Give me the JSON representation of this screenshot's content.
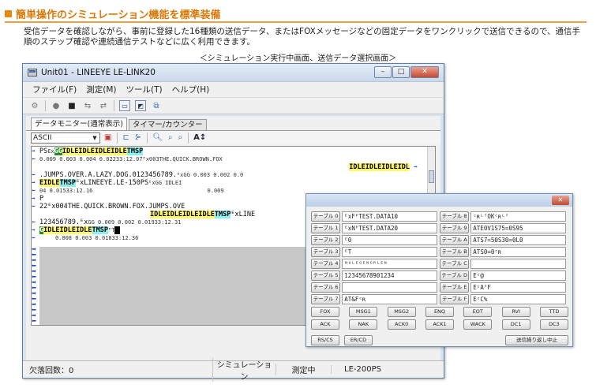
{
  "header": {
    "heading": "簡単操作のシミュレーション機能を標準装備",
    "description": "受信データを確認しながら、事前に登録した16種類の送信データ、またはFOXメッセージなどの固定データをワンクリックで送信できるので、通信手順のステップ確認や連続通信テストなどに広く利用できます。",
    "caption": "＜シミュレーション実行中画面、送信データ選択画面＞"
  },
  "window": {
    "title": "Unit01 - LINEEYE LE-LINK20",
    "controls": [
      "–",
      "□",
      "✕"
    ],
    "menu": [
      "ファイル(F)",
      "測定(M)",
      "ツール(T)",
      "ヘルプ(H)"
    ],
    "tabs": [
      "データモニター(通常表示)",
      "タイマー/カウンター"
    ],
    "code_select": "ASCII",
    "monitor_rows": [
      {
        "prefix": "PS",
        "parts": [
          {
            "t": "ᴱx",
            "c": "n"
          },
          {
            "t": "GG",
            "c": "gr"
          },
          {
            "t": "IDLEIDLEIDLEIDLE",
            "c": "yl"
          },
          {
            "t": "TMSP",
            "c": "cy"
          }
        ],
        "trail": "",
        "sub": "0.009   0.003   0.004   0.02233:12.07ᴱx003THE.QUICK.BROWN.FOX"
      },
      {
        "prefix": "",
        "parts": [
          {
            "t": "IDLEIDLEIDLEIDL",
            "c": "yl"
          }
        ],
        "trail": "",
        "sub": ""
      },
      {
        "prefix": "",
        "parts": [],
        "trail": ".JUMPS.OVER.A.LAZY.DOG.0123456789.",
        "sub": "ᴱxGG  0.003   0.002   0.0"
      },
      {
        "prefix": "",
        "parts": [
          {
            "t": "EIDLE",
            "c": "yl"
          },
          {
            "t": "TMSP",
            "c": "cy"
          }
        ],
        "trail": "ᴱxLINEEYE.LE-150PS",
        "sub": "ᴱxGG IDLEI"
      },
      {
        "prefix": "",
        "parts": [],
        "trail": "04  0.01533:12.16",
        "sub": "0.009"
      },
      {
        "prefix": "P",
        "parts": [],
        "trail": "",
        "sub": ""
      },
      {
        "prefix": "",
        "parts": [],
        "trail": "22ᴱx004THE.QUICK.BROWN.FOX.JUMPS.OVE",
        "sub": ""
      },
      {
        "prefix": "",
        "parts": [
          {
            "t": "IDLEIDLEIDLEIDLE",
            "c": "yl"
          },
          {
            "t": "TMSP",
            "c": "cy"
          }
        ],
        "trail": "ᴱxLINE",
        "sub": ""
      },
      {
        "prefix": "",
        "parts": [],
        "trail": "123456789.ᴱx",
        "sub": "GG 0.009   0.002   0.01933:12.31"
      },
      {
        "prefix": "",
        "parts": [
          {
            "t": "G",
            "c": "gr"
          },
          {
            "t": "IDLEIDLEIDLE",
            "c": "yl"
          },
          {
            "t": "TMSP",
            "c": "cy"
          }
        ],
        "trail": "ᴱT",
        "sub": ""
      },
      {
        "prefix": "",
        "parts": [],
        "trail": "0.008   0.003   0.01833:12.36",
        "sub": ""
      }
    ],
    "status": {
      "drop_count": "欠落回数：0",
      "mode": "シミュレーション",
      "state": "測定中",
      "model": "LE-200PS"
    }
  },
  "dialog": {
    "close": "✕",
    "tables_left": [
      {
        "label": "テーブル 0",
        "value": "ᴱxFᴾTEST.DATA10"
      },
      {
        "label": "テーブル 1",
        "value": "ᴱxNᴾTEST.DATA20"
      },
      {
        "label": "テーブル 2",
        "value": "ᴱ0"
      },
      {
        "label": "テーブル 3",
        "value": "ᴱT"
      },
      {
        "label": "テーブル 4",
        "value": "ᴺᵁᴸᴱᴳᴱᴺᴳᴿᴸᴱᴺ"
      },
      {
        "label": "テーブル 5",
        "value": "12345678901234"
      },
      {
        "label": "テーブル 6",
        "value": ""
      },
      {
        "label": "テーブル 7",
        "value": "AT&Fᶜʀ"
      }
    ],
    "tables_right": [
      {
        "label": "テーブル 8",
        "value": "ᶜʀᴸᶠOKᶜʀᴸᶠ"
      },
      {
        "label": "テーブル 9",
        "value": "ATE0V1S75=0S95"
      },
      {
        "label": "テーブル A",
        "value": "ATS7=50S30=0L0"
      },
      {
        "label": "テーブル B",
        "value": "ATS0=0ᶜʀ"
      },
      {
        "label": "テーブル C",
        "value": ""
      },
      {
        "label": "テーブル D",
        "value": "Eᶜ@"
      },
      {
        "label": "テーブル E",
        "value": "EᶜAᶠF"
      },
      {
        "label": "テーブル F",
        "value": "EᶜC%"
      }
    ],
    "commands_row1": [
      "FOX",
      "MSG1",
      "MSG2",
      "ENQ",
      "EOT",
      "RVI",
      "TTD"
    ],
    "commands_row2": [
      "ACK",
      "NAK",
      "ACK0",
      "ACK1",
      "WACK",
      "DC1",
      "DC3"
    ],
    "commands_row3": [
      "RS/CS",
      "ER/CD"
    ],
    "repeat_stop": "送信繰り返し中止"
  }
}
